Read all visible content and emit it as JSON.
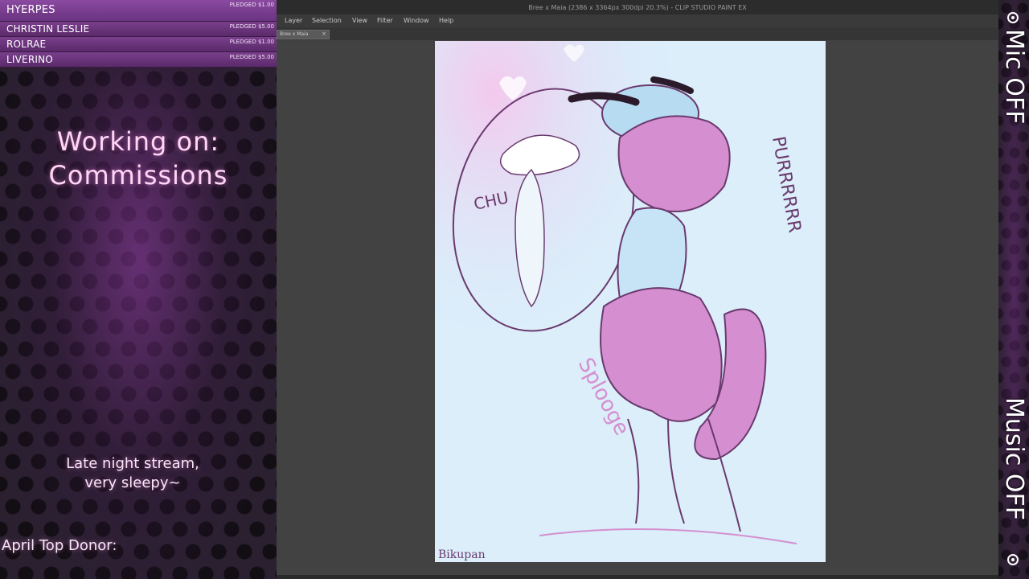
{
  "pledges": [
    {
      "name": "HYERPES",
      "amount": "PLEDGED $1.00"
    },
    {
      "name": "CHRISTIN LESLIE",
      "amount": "PLEDGED $5.00"
    },
    {
      "name": "ROLRAE",
      "amount": "PLEDGED $1.00"
    },
    {
      "name": "LIVERINO",
      "amount": "PLEDGED $5.00"
    }
  ],
  "overlay": {
    "working_line1": "Working on:",
    "working_line2": "Commissions",
    "tagline_line1": "Late night stream,",
    "tagline_line2": "very sleepy~",
    "top_donor": "April Top Donor:"
  },
  "app": {
    "title": "Bree x Maia (2386 x 3364px 300dpi 20.3%) - CLIP STUDIO PAINT EX",
    "menu": [
      "Layer",
      "Selection",
      "View",
      "Filter",
      "Window",
      "Help"
    ],
    "tab_label": "Bree x Maia",
    "tab_close": "×"
  },
  "artwork": {
    "text_chu": "CHU",
    "text_sfx": "PURRRRRR",
    "text_splooge": "Splooge",
    "signature": "Bikupan"
  },
  "status": {
    "mic": "Mic OFF",
    "music": "Music OFF"
  },
  "colors": {
    "overlay_accent": "#7a3f8c",
    "overlay_text": "#ffd6f5",
    "art_pink": "#d58fd0",
    "art_line": "#6a3a6e",
    "art_bg": "#d9ebf8"
  },
  "icons": {
    "status_indicator": "record-dot-icon"
  }
}
